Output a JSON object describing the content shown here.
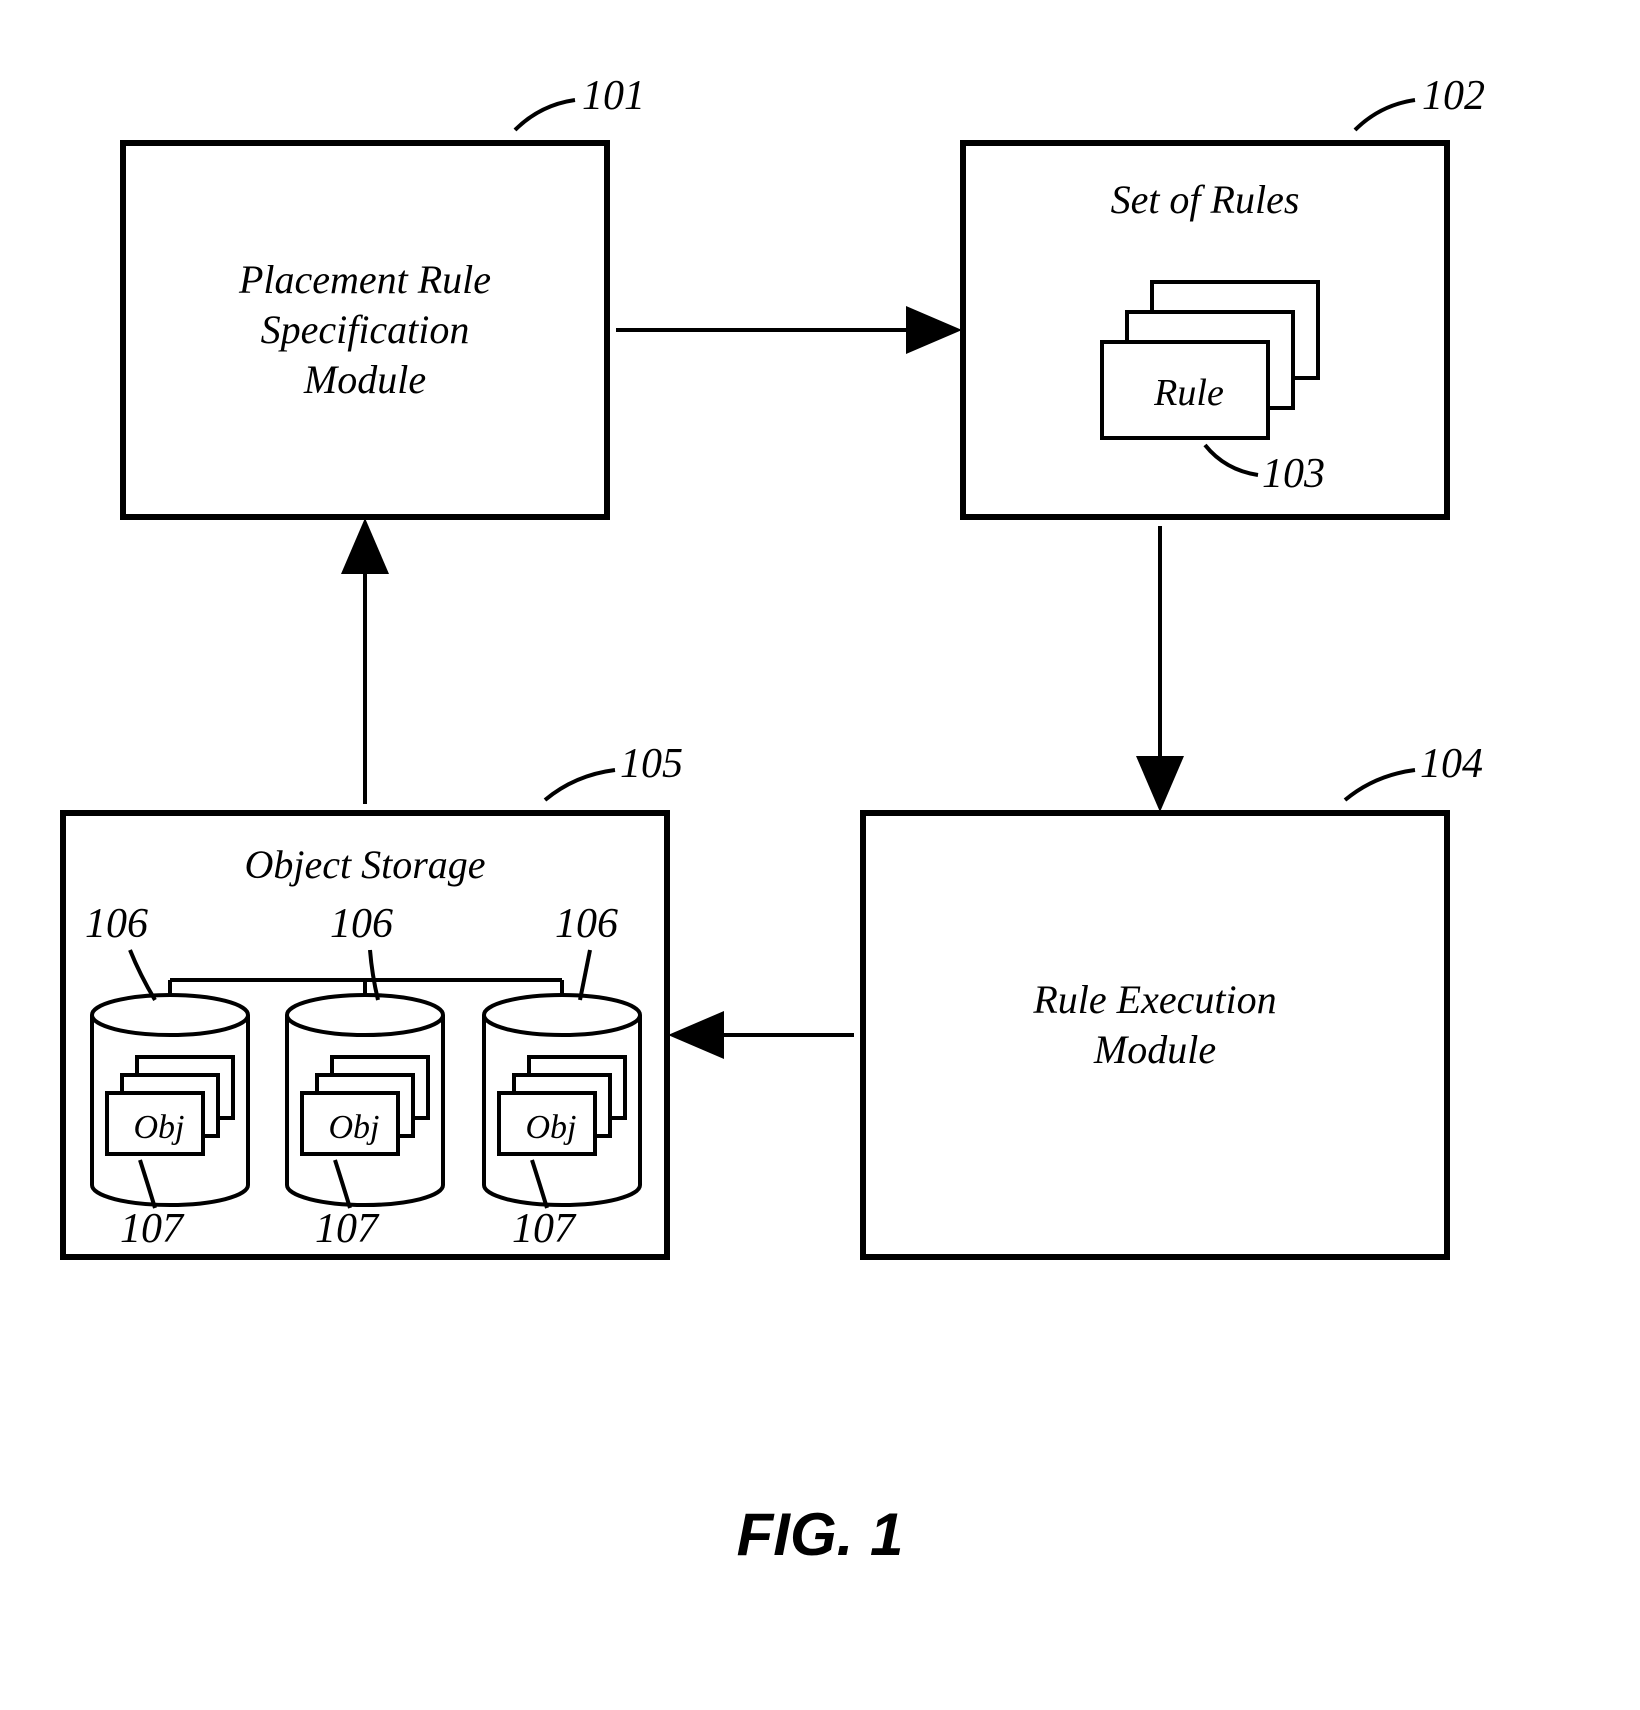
{
  "boxes": {
    "b101": {
      "ref": "101",
      "text": "Placement Rule\nSpecification\nModule"
    },
    "b102": {
      "ref": "102",
      "title": "Set of Rules",
      "card_label": "Rule",
      "card_ref": "103"
    },
    "b104": {
      "ref": "104",
      "text": "Rule Execution\nModule"
    },
    "b105": {
      "ref": "105",
      "title": "Object Storage",
      "cyl_ref": "106",
      "obj_label": "Obj",
      "obj_ref": "107"
    }
  },
  "figure_caption": "FIG. 1"
}
